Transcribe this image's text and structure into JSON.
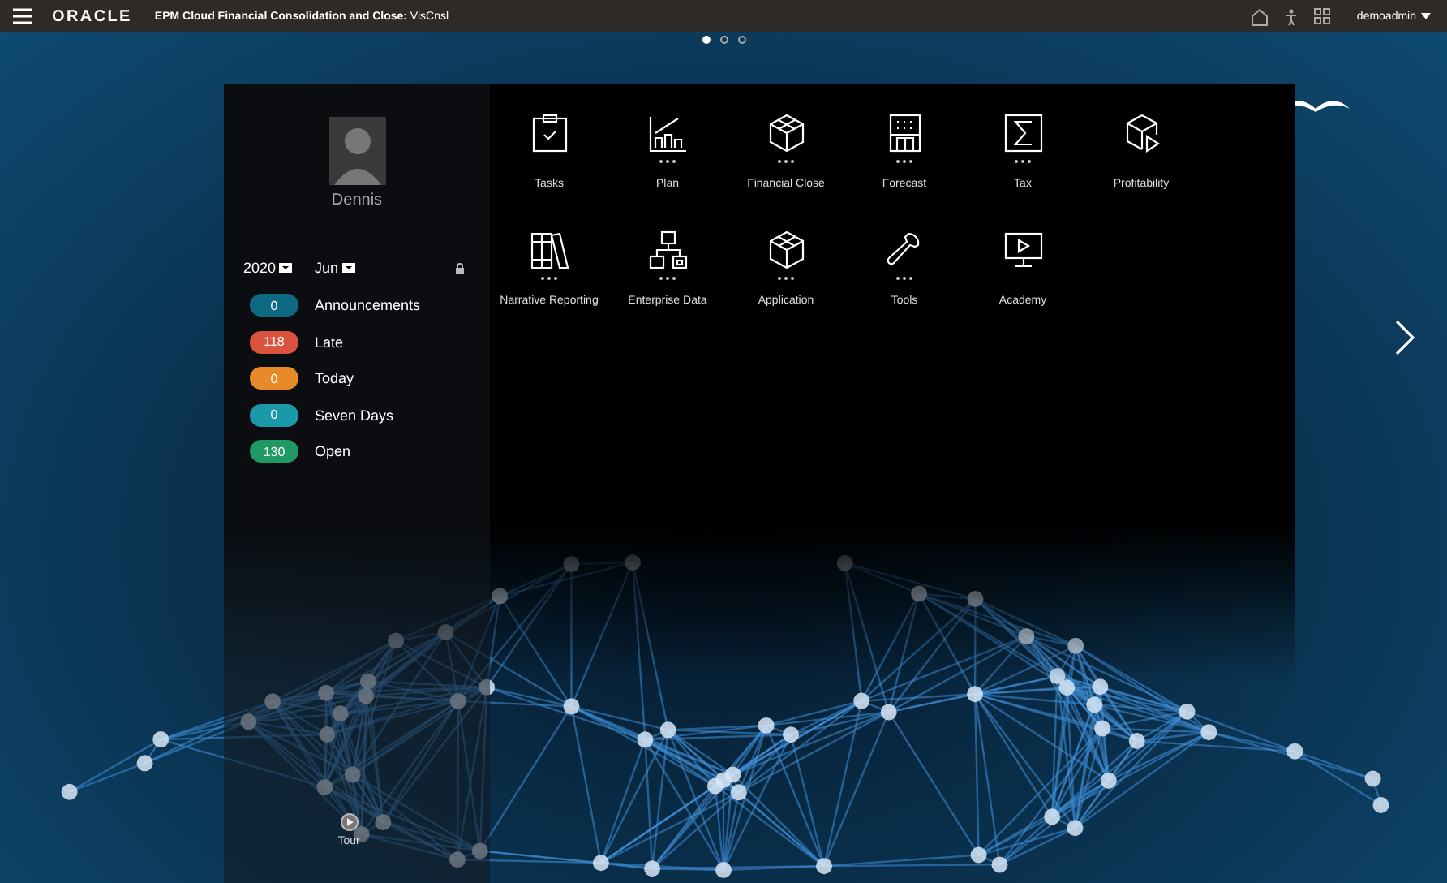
{
  "header": {
    "logo": "ORACLE",
    "title": "**EPM Cloud Financial Consolidation and Close:** VisCnsl",
    "user": "demoadmin"
  },
  "pager": [
    {
      "selected": true
    },
    {
      "selected": false
    },
    {
      "selected": false
    }
  ],
  "profile": {
    "name": "Dennis",
    "year": "2020",
    "month": "Jun"
  },
  "counters": [
    {
      "count": "0",
      "label": "Announcements",
      "color": "#0e6a82"
    },
    {
      "count": "118",
      "label": "Late",
      "color": "#d9533f"
    },
    {
      "count": "0",
      "label": "Today",
      "color": "#e8892a"
    },
    {
      "count": "0",
      "label": "Seven Days",
      "color": "#1a9aa8"
    },
    {
      "count": "130",
      "label": "Open",
      "color": "#1f9a62"
    }
  ],
  "tiles": [
    {
      "kind": "clipboard",
      "label": "Tasks",
      "has_menu": false
    },
    {
      "kind": "chart",
      "label": "Plan",
      "has_menu": true
    },
    {
      "kind": "cube",
      "label": "Financial Close",
      "has_menu": true
    },
    {
      "kind": "building",
      "label": "Forecast",
      "has_menu": true
    },
    {
      "kind": "sigma",
      "label": "Tax",
      "has_menu": true
    },
    {
      "kind": "cubeplay",
      "label": "Profitability",
      "has_menu": false
    },
    {
      "kind": "books",
      "label": "Narrative Reporting",
      "has_menu": true
    },
    {
      "kind": "hierarchy",
      "label": "Enterprise Data",
      "has_menu": true
    },
    {
      "kind": "cube",
      "label": "Application",
      "has_menu": true
    },
    {
      "kind": "wrench",
      "label": "Tools",
      "has_menu": true
    },
    {
      "kind": "monitor",
      "label": "Academy",
      "has_menu": false
    }
  ],
  "tour": {
    "label": "Tour"
  }
}
